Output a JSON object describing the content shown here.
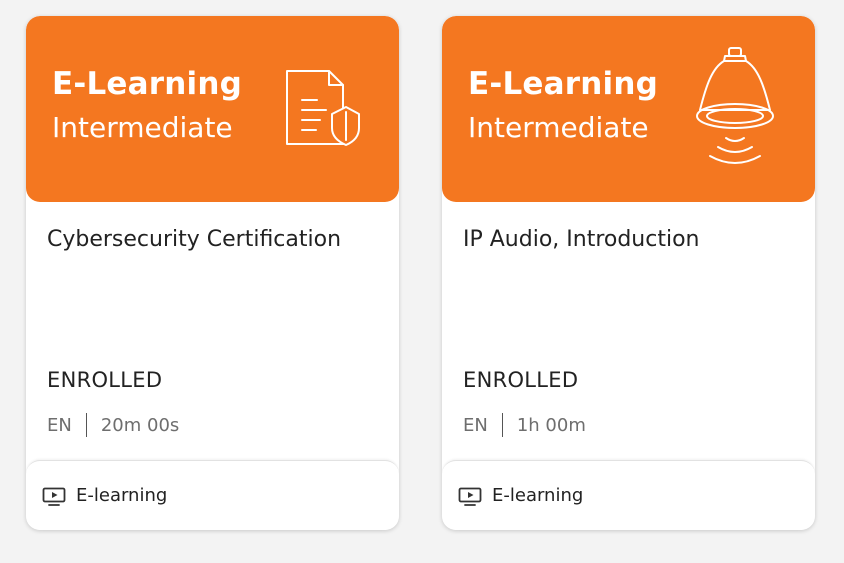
{
  "cards": [
    {
      "banner": {
        "type_label": "E-Learning",
        "level_label": "Intermediate",
        "icon": "document-shield-icon",
        "color": "#f47720"
      },
      "title": "Cybersecurity Certification",
      "status": "ENROLLED",
      "language": "EN",
      "duration": "20m 00s",
      "footer": {
        "icon": "video-play-icon",
        "label": "E-learning"
      }
    },
    {
      "banner": {
        "type_label": "E-Learning",
        "level_label": "Intermediate",
        "icon": "ceiling-speaker-icon",
        "color": "#f47720"
      },
      "title": "IP Audio, Introduction",
      "status": "ENROLLED",
      "language": "EN",
      "duration": "1h 00m",
      "footer": {
        "icon": "video-play-icon",
        "label": "E-learning"
      }
    }
  ]
}
